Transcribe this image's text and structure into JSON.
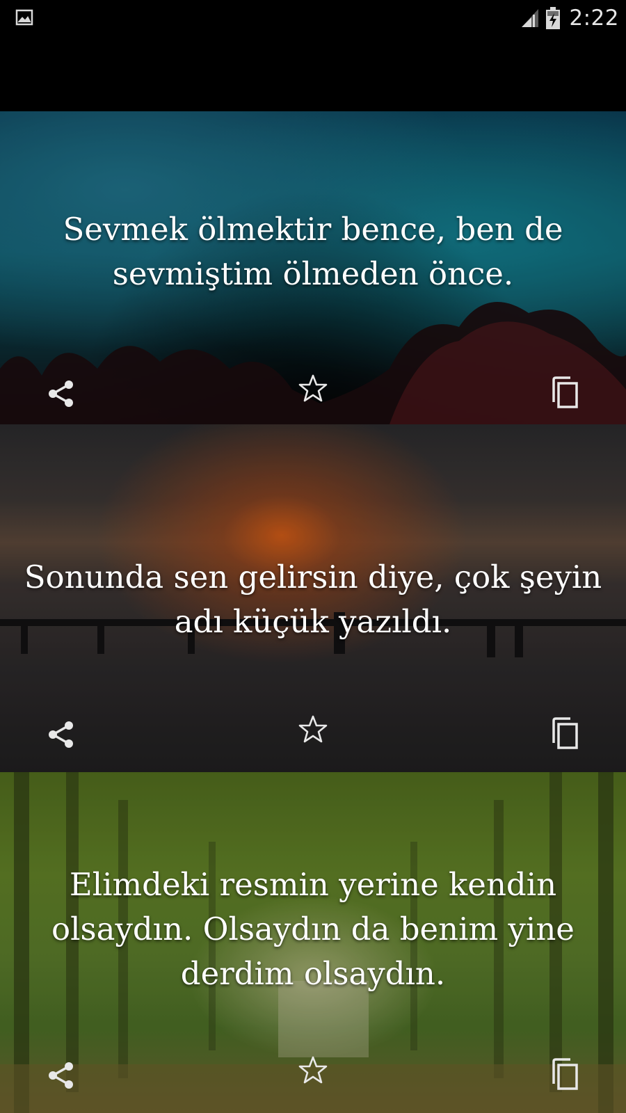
{
  "status_bar": {
    "time": "2:22",
    "left_icon": "image-icon",
    "signal_icon": "signal-icon",
    "battery_icon": "battery-charging-icon"
  },
  "quotes": [
    {
      "text": "Sevmek ölmektir bence, ben de sevmiştim ölmeden önce.",
      "background": "night-sky-trees"
    },
    {
      "text": "Sonunda sen gelirsin diye, çok şeyin adı küçük yazıldı.",
      "background": "sunset-pier"
    },
    {
      "text": "Elimdeki resmin yerine kendin olsaydın. Olsaydın da benim yine derdim olsaydın.",
      "background": "forest-path"
    }
  ],
  "actions": {
    "share_icon": "share-icon",
    "favorite_icon": "star-outline-icon",
    "copy_icon": "copy-icon"
  },
  "colors": {
    "status_bar_bg": "#000000",
    "quote_text": "#ffffff",
    "icon_color": "#e8e8e8"
  }
}
